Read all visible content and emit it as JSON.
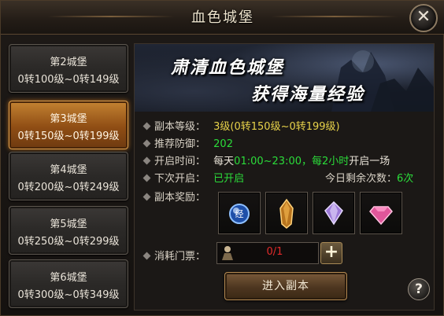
{
  "window": {
    "title": "血色城堡",
    "close_label": "✕"
  },
  "nav": {
    "items": [
      {
        "line1": "第2城堡",
        "line2": "0转100级~0转149级",
        "active": false
      },
      {
        "line1": "第3城堡",
        "line2": "0转150级~0转199级",
        "active": true
      },
      {
        "line1": "第4城堡",
        "line2": "0转200级~0转249级",
        "active": false
      },
      {
        "line1": "第5城堡",
        "line2": "0转250级~0转299级",
        "active": false
      },
      {
        "line1": "第6城堡",
        "line2": "0转300级~0转349级",
        "active": false
      }
    ]
  },
  "banner": {
    "line1": "肃清血色城堡",
    "line2": "获得海量经验"
  },
  "details": {
    "level_label": "副本等级：",
    "level_value": "3级(0转150级~0转199级)",
    "defense_label": "推荐防御：",
    "defense_value": "202",
    "open_label": "开启时间：",
    "open_prefix": "每天",
    "open_time": "01:00~23:00，每2小时",
    "open_suffix": "开启一场",
    "next_label": "下次开启：",
    "next_value": "已开启",
    "remaining_label": "今日剩余次数：",
    "remaining_value": "6次",
    "reward_label": "副本奖励：",
    "reward_icons": [
      "exp-orb-icon",
      "amber-crystal-icon",
      "purple-gem-icon",
      "pink-gem-icon"
    ],
    "ticket_label": "消耗门票：",
    "ticket_count": "0/1",
    "plus_label": "+",
    "enter_label": "进入副本",
    "help_label": "?"
  },
  "colors": {
    "accent_orange": "#c48332",
    "value_yellow": "#e7d24a",
    "value_green": "#2bdc3a",
    "ticket_red": "#e22a2a"
  }
}
